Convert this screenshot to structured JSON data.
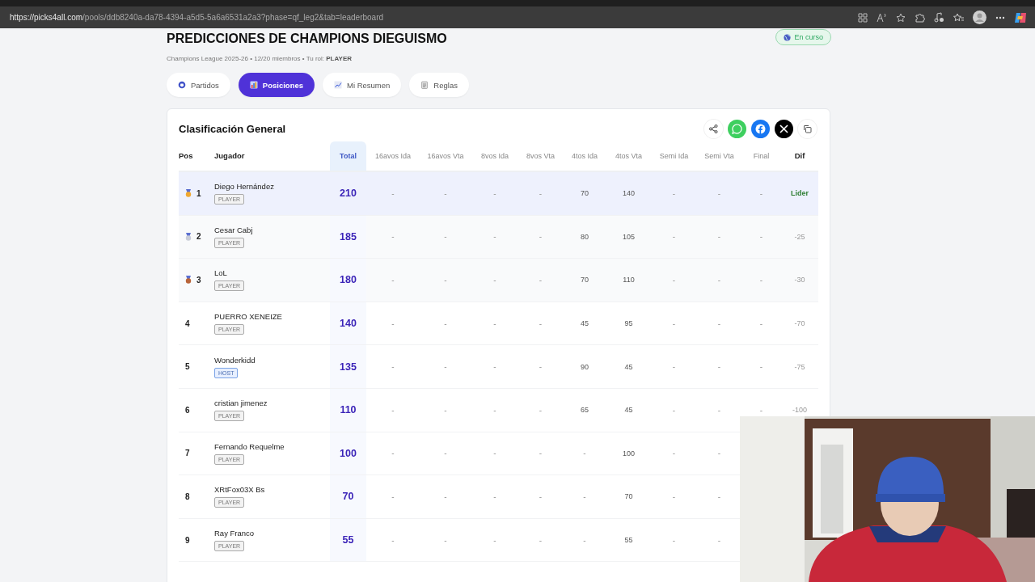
{
  "browser": {
    "url_host": "https://picks4all.com",
    "url_path": "/pools/ddb8240a-da78-4394-a5d5-5a6a6531a2a3?phase=qf_leg2&tab=leaderboard"
  },
  "pool": {
    "title": "PREDICCIONES DE CHAMPIONS DIEGUISMO",
    "subtitle": "Champions League 2025-26 • 12/20 miembros • Tu rol: **PLAYER**",
    "status": "En curso"
  },
  "tabs": [
    {
      "label": "Partidos",
      "selected": false
    },
    {
      "label": "Posiciones",
      "selected": true
    },
    {
      "label": "Mi Resumen",
      "selected": false
    },
    {
      "label": "Reglas",
      "selected": false
    }
  ],
  "leaderboard": {
    "title": "Clasificación General",
    "columns": [
      "Pos",
      "Jugador",
      "Total",
      "16avos Ida",
      "16avos Vta",
      "8vos Ida",
      "8vos Vta",
      "4tos Ida",
      "4tos Vta",
      "Semi Ida",
      "Semi Vta",
      "Final",
      "Dif"
    ],
    "rows": [
      {
        "color": "#f0a830",
        "role": "PLAYER",
        "host": false,
        "leader": true,
        "cells": [
          "1",
          "Diego Hernández",
          "210",
          "-",
          "-",
          "-",
          "-",
          "70",
          "140",
          "-",
          "-",
          "-",
          "Lider"
        ]
      },
      {
        "color": "#c9ccd8",
        "role": "PLAYER",
        "host": false,
        "leader": false,
        "cells": [
          "2",
          "Cesar Cabj",
          "185",
          "-",
          "-",
          "-",
          "-",
          "80",
          "105",
          "-",
          "-",
          "-",
          "-25"
        ]
      },
      {
        "color": "#b8643a",
        "role": "PLAYER",
        "host": false,
        "leader": false,
        "cells": [
          "3",
          "LoL",
          "180",
          "-",
          "-",
          "-",
          "-",
          "70",
          "110",
          "-",
          "-",
          "-",
          "-30"
        ]
      },
      {
        "role": "PLAYER",
        "host": false,
        "leader": false,
        "cells": [
          "4",
          "PUERRO XENEIZE",
          "140",
          "-",
          "-",
          "-",
          "-",
          "45",
          "95",
          "-",
          "-",
          "-",
          "-70"
        ]
      },
      {
        "role": "HOST",
        "host": true,
        "leader": false,
        "cells": [
          "5",
          "Wonderkidd",
          "135",
          "-",
          "-",
          "-",
          "-",
          "90",
          "45",
          "-",
          "-",
          "-",
          "-75"
        ]
      },
      {
        "role": "PLAYER",
        "host": false,
        "leader": false,
        "cells": [
          "6",
          "cristian jimenez",
          "110",
          "-",
          "-",
          "-",
          "-",
          "65",
          "45",
          "-",
          "-",
          "-",
          "-100"
        ]
      },
      {
        "role": "PLAYER",
        "host": false,
        "leader": false,
        "cells": [
          "7",
          "Fernando Requelme",
          "100",
          "-",
          "-",
          "-",
          "-",
          "-",
          "100",
          "-",
          "-"
        ]
      },
      {
        "role": "PLAYER",
        "host": false,
        "leader": false,
        "cells": [
          "8",
          "XRtFox03X Bs",
          "70",
          "-",
          "-",
          "-",
          "-",
          "-",
          "70",
          "-",
          "-"
        ]
      },
      {
        "role": "PLAYER",
        "host": false,
        "leader": false,
        "cells": [
          "9",
          "Ray Franco",
          "55",
          "-",
          "-",
          "-",
          "-",
          "-",
          "55",
          "-",
          "-"
        ]
      }
    ]
  }
}
